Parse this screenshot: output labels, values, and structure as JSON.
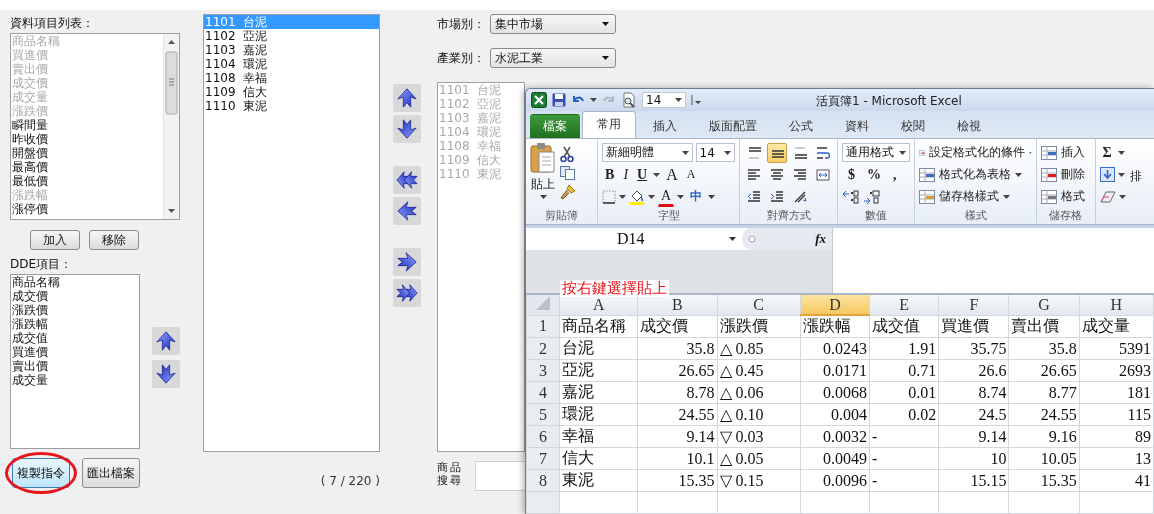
{
  "data_items": {
    "label": "資料項目列表：",
    "items": [
      {
        "text": "商品名稱",
        "disabled": true
      },
      {
        "text": "買進價",
        "disabled": true
      },
      {
        "text": "賣出價",
        "disabled": true
      },
      {
        "text": "成交價",
        "disabled": true
      },
      {
        "text": "成交量",
        "disabled": true
      },
      {
        "text": "漲跌價",
        "disabled": true
      },
      {
        "text": "瞬間量",
        "disabled": false
      },
      {
        "text": "昨收價",
        "disabled": false
      },
      {
        "text": "開盤價",
        "disabled": false
      },
      {
        "text": "最高價",
        "disabled": false
      },
      {
        "text": "最低價",
        "disabled": false
      },
      {
        "text": "漲跌幅",
        "disabled": true
      },
      {
        "text": "漲停價",
        "disabled": false
      }
    ]
  },
  "item_buttons": [
    "加入",
    "移除"
  ],
  "dde": {
    "label": "DDE項目：",
    "items": [
      "商品名稱",
      "成交價",
      "漲跌價",
      "漲跌幅",
      "成交值",
      "買進價",
      "賣出價",
      "成交量"
    ],
    "move_buttons": [
      {
        "kind": "up"
      },
      {
        "kind": "down"
      }
    ]
  },
  "action_buttons": [
    {
      "label": "複製指令",
      "focused": true,
      "circled": true
    },
    {
      "label": "匯出檔案",
      "focused": false,
      "circled": false
    }
  ],
  "stocks": {
    "items": [
      {
        "code": "1101",
        "name": "台泥",
        "selected": true
      },
      {
        "code": "1102",
        "name": "亞泥",
        "selected": false
      },
      {
        "code": "1103",
        "name": "嘉泥",
        "selected": false
      },
      {
        "code": "1104",
        "name": "環泥",
        "selected": false
      },
      {
        "code": "1108",
        "name": "幸福",
        "selected": false
      },
      {
        "code": "1109",
        "name": "信大",
        "selected": false
      },
      {
        "code": "1110",
        "name": "東泥",
        "selected": false
      }
    ],
    "count": "( 7 / 220 )"
  },
  "transfer_buttons": [
    {
      "kind": "up"
    },
    {
      "kind": "down"
    },
    {
      "kind": "all-left"
    },
    {
      "kind": "left"
    },
    {
      "kind": "right"
    },
    {
      "kind": "all-right"
    }
  ],
  "filters": [
    {
      "label": "市場別：",
      "value": "集中市場"
    },
    {
      "label": "產業別：",
      "value": "水泥工業"
    }
  ],
  "picked": {
    "items": [
      {
        "code": "1101",
        "name": "台泥",
        "disabled": true
      },
      {
        "code": "1102",
        "name": "亞泥",
        "disabled": true
      },
      {
        "code": "1103",
        "name": "嘉泥",
        "disabled": true
      },
      {
        "code": "1104",
        "name": "環泥",
        "disabled": true
      },
      {
        "code": "1108",
        "name": "幸福",
        "disabled": true
      },
      {
        "code": "1109",
        "name": "信大",
        "disabled": true
      },
      {
        "code": "1110",
        "name": "東泥",
        "disabled": true
      }
    ]
  },
  "search": {
    "label": "商品搜尋"
  },
  "excel": {
    "title": "活頁簿1 - Microsoft Excel",
    "quick_font_size": "14",
    "tabs": [
      {
        "label": "檔案",
        "kind": "file",
        "selected": false
      },
      {
        "label": "常用",
        "kind": "tab",
        "selected": true
      },
      {
        "label": "插入",
        "kind": "tab",
        "selected": false
      },
      {
        "label": "版面配置",
        "kind": "tab",
        "selected": false
      },
      {
        "label": "公式",
        "kind": "tab",
        "selected": false
      },
      {
        "label": "資料",
        "kind": "tab",
        "selected": false
      },
      {
        "label": "校閱",
        "kind": "tab",
        "selected": false
      },
      {
        "label": "檢視",
        "kind": "tab",
        "selected": false
      }
    ],
    "ribbon": {
      "clipboard": {
        "label": "剪貼簿",
        "paste": "貼上"
      },
      "font": {
        "label": "字型",
        "name": "新細明體",
        "size": "14",
        "styles": [
          "B",
          "I",
          "U"
        ],
        "grow": [
          "A",
          "A"
        ],
        "color_label": "A",
        "phonetic": "中"
      },
      "alignment": {
        "label": "對齊方式",
        "buttons": [
          {
            "kind": "top",
            "selected": false
          },
          {
            "kind": "middle",
            "selected": true
          },
          {
            "kind": "bottom",
            "selected": false
          },
          {
            "kind": "wrap",
            "selected": false
          }
        ]
      },
      "number": {
        "label": "數值",
        "format": "通用格式",
        "symbols": [
          "$",
          "%",
          ","
        ]
      },
      "styles": {
        "label": "樣式",
        "commands": [
          "設定格式化的條件",
          "格式化為表格",
          "儲存格樣式"
        ]
      },
      "cells": {
        "label": "儲存格",
        "commands": [
          "插入",
          "刪除",
          "格式"
        ]
      },
      "editing": {
        "symbol": "Σ",
        "cut_label": "排"
      }
    },
    "name_box": "D14",
    "fx": "fx",
    "note": "按右鍵選擇貼上",
    "columns": [
      {
        "label": "A",
        "kind": "text",
        "selected": false
      },
      {
        "label": "B",
        "kind": "number",
        "selected": false
      },
      {
        "label": "C",
        "kind": "text",
        "selected": false
      },
      {
        "label": "D",
        "kind": "number",
        "selected": true
      },
      {
        "label": "E",
        "kind": "number",
        "selected": false
      },
      {
        "label": "F",
        "kind": "number",
        "selected": false
      },
      {
        "label": "G",
        "kind": "number",
        "selected": false
      },
      {
        "label": "H",
        "kind": "number",
        "selected": false
      }
    ],
    "rows": [
      {
        "number": "1",
        "kind": "header",
        "cells": [
          "商品名稱",
          "成交價",
          "漲跌價",
          "漲跌幅",
          "成交值",
          "買進價",
          "賣出價",
          "成交量"
        ]
      },
      {
        "number": "2",
        "kind": "data",
        "cells": [
          "台泥",
          "35.8",
          "△ 0.85",
          "0.0243",
          "1.91",
          "35.75",
          "35.8",
          "5391"
        ]
      },
      {
        "number": "3",
        "kind": "data",
        "cells": [
          "亞泥",
          "26.65",
          "△ 0.45",
          "0.0171",
          "0.71",
          "26.6",
          "26.65",
          "2693"
        ]
      },
      {
        "number": "4",
        "kind": "data",
        "cells": [
          "嘉泥",
          "8.78",
          "△ 0.06",
          "0.0068",
          "0.01",
          "8.74",
          "8.77",
          "181"
        ]
      },
      {
        "number": "5",
        "kind": "data",
        "cells": [
          "環泥",
          "24.55",
          "△ 0.10",
          "0.004",
          "0.02",
          "24.5",
          "24.55",
          "115"
        ]
      },
      {
        "number": "6",
        "kind": "data",
        "cells": [
          "幸福",
          "9.14",
          "▽ 0.03",
          "0.0032",
          {
            "text": "-",
            "kind": "text"
          },
          "9.14",
          "9.16",
          "89"
        ]
      },
      {
        "number": "7",
        "kind": "data",
        "cells": [
          "信大",
          "10.1",
          "△ 0.05",
          "0.0049",
          {
            "text": "-",
            "kind": "text"
          },
          "10",
          "10.05",
          "13"
        ]
      },
      {
        "number": "8",
        "kind": "data",
        "cells": [
          "東泥",
          "15.35",
          "▽ 0.15",
          "0.0096",
          {
            "text": "-",
            "kind": "text"
          },
          "15.15",
          "15.35",
          "41"
        ]
      }
    ]
  }
}
